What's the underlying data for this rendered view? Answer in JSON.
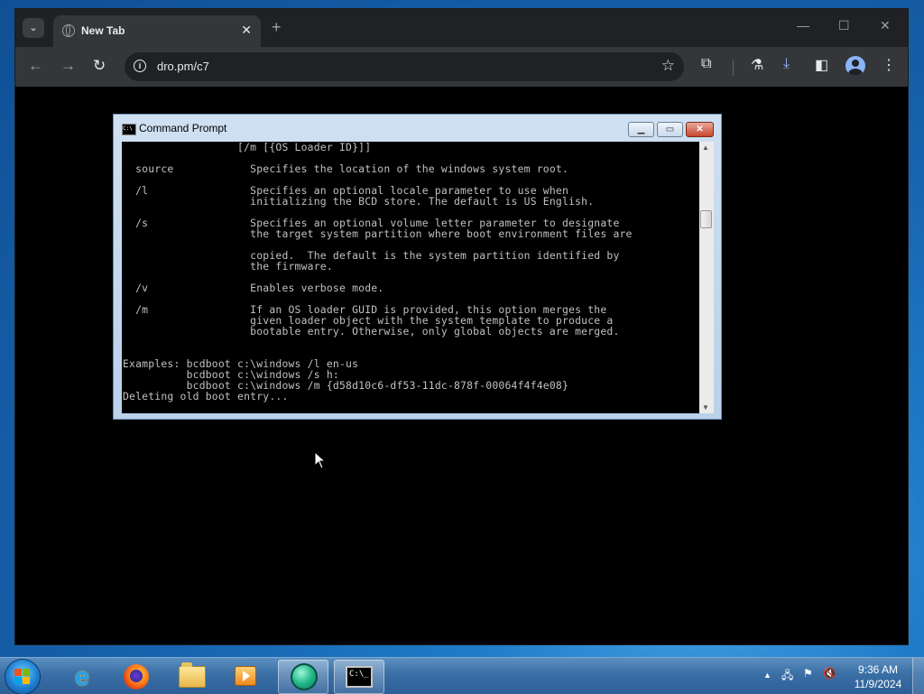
{
  "browser": {
    "tab_title": "New Tab",
    "tab_close": "✕",
    "new_tab": "+",
    "tab_search": "⌄",
    "window_controls": {
      "minimize": "—",
      "maximize": "☐",
      "close": "✕"
    },
    "nav": {
      "back": "←",
      "forward": "→",
      "reload": "↻"
    },
    "address": {
      "url": "dro.pm/c7",
      "info": "i"
    },
    "toolbar_icons": {
      "star": "☆",
      "extensions": "⧉",
      "labs": "⚗",
      "download": "⤓",
      "sidepanel": "◧",
      "menu": "⋮"
    }
  },
  "cmd": {
    "title": "Command Prompt",
    "icon_text": "C:\\",
    "buttons": {
      "minimize": "▁",
      "maximize": "▭",
      "close": "✕"
    },
    "lines": [
      "                  [/m [{OS Loader ID}]]",
      "",
      "  source            Specifies the location of the windows system root.",
      "",
      "  /l                Specifies an optional locale parameter to use when",
      "                    initializing the BCD store. The default is US English.",
      "",
      "  /s                Specifies an optional volume letter parameter to designate",
      "                    the target system partition where boot environment files are",
      "",
      "                    copied.  The default is the system partition identified by",
      "                    the firmware.",
      "",
      "  /v                Enables verbose mode.",
      "",
      "  /m                If an OS loader GUID is provided, this option merges the",
      "                    given loader object with the system template to produce a",
      "                    bootable entry. Otherwise, only global objects are merged.",
      "",
      "",
      "Examples: bcdboot c:\\windows /l en-us",
      "          bcdboot c:\\windows /s h:",
      "          bcdboot c:\\windows /m {d58d10c6-df53-11dc-878f-00064f4f4e08}",
      "Deleting old boot entry..."
    ]
  },
  "taskbar": {
    "cmd_icon_text": "C:\\_",
    "tray": {
      "chevron": "▲",
      "network": "🖧",
      "flag": "⚑",
      "volume": "🔇"
    },
    "clock": {
      "time": "9:36 AM",
      "date": "11/9/2024"
    }
  },
  "colors": {
    "chrome_dark": "#202124",
    "chrome_toolbar": "#35363a",
    "cmd_text": "#c0c0c0",
    "taskbar": "#3a6fa6"
  }
}
